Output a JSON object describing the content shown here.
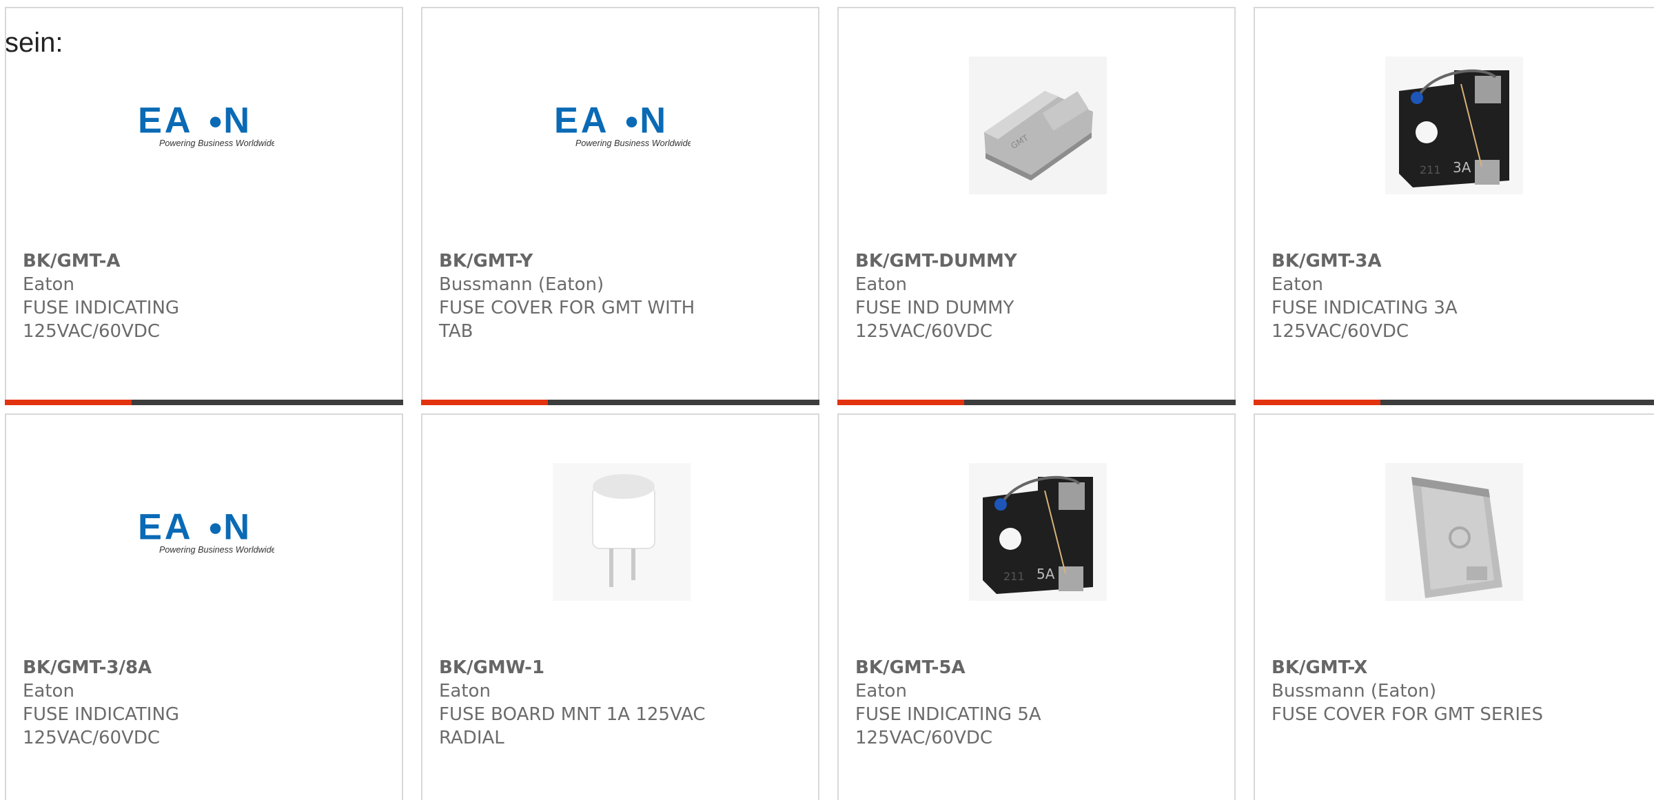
{
  "intro_text": "sein:",
  "colors": {
    "accent": "#e2330f",
    "bar_dark": "#3d3d3d",
    "text": "#6b6b6b",
    "eaton_blue": "#0a6ab5"
  },
  "products": [
    {
      "mpn": "BK/GMT-A",
      "manufacturer": "Eaton",
      "desc1": "FUSE INDICATING",
      "desc2": "125VAC/60VDC",
      "image": "eaton-logo",
      "logo_text": "E·T·N",
      "logo_tagline": "Powering Business Worldwide"
    },
    {
      "mpn": "BK/GMT-Y",
      "manufacturer": "Bussmann (Eaton)",
      "desc1": "FUSE COVER FOR GMT WITH",
      "desc2": "TAB",
      "image": "eaton-logo",
      "logo_text": "E·T·N",
      "logo_tagline": "Powering Business Worldwide"
    },
    {
      "mpn": "BK/GMT-DUMMY",
      "manufacturer": "Eaton",
      "desc1": "FUSE IND DUMMY",
      "desc2": "125VAC/60VDC",
      "image": "gray-dummy-fuse"
    },
    {
      "mpn": "BK/GMT-3A",
      "manufacturer": "Eaton",
      "desc1": "FUSE INDICATING 3A",
      "desc2": "125VAC/60VDC",
      "image": "black-indicating-fuse",
      "fuse_marking": "3A"
    },
    {
      "mpn": "BK/GMT-3/8A",
      "manufacturer": "Eaton",
      "desc1": "FUSE INDICATING",
      "desc2": "125VAC/60VDC",
      "image": "eaton-logo",
      "logo_text": "E·T·N",
      "logo_tagline": "Powering Business Worldwide"
    },
    {
      "mpn": "BK/GMW-1",
      "manufacturer": "Eaton",
      "desc1": "FUSE BOARD MNT 1A 125VAC",
      "desc2": "RADIAL",
      "image": "white-radial-fuse"
    },
    {
      "mpn": "BK/GMT-5A",
      "manufacturer": "Eaton",
      "desc1": "FUSE INDICATING 5A",
      "desc2": "125VAC/60VDC",
      "image": "black-indicating-fuse",
      "fuse_marking": "5A"
    },
    {
      "mpn": "BK/GMT-X",
      "manufacturer": "Bussmann (Eaton)",
      "desc1": "FUSE COVER FOR GMT SERIES",
      "desc2": "",
      "image": "gray-fuse-cover"
    }
  ]
}
